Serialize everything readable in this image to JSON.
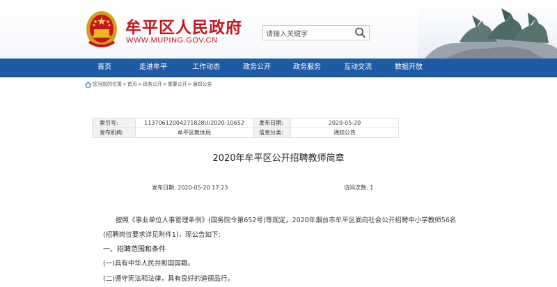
{
  "header": {
    "site_name": "牟平区人民政府",
    "site_url": "WWW.MUPING.GOV.CN",
    "search_placeholder": "请输入关键字"
  },
  "nav": {
    "items": [
      "首页",
      "走进牟平",
      "工作动态",
      "政务公开",
      "政务服务",
      "互动交流",
      "数据开放"
    ]
  },
  "breadcrumb": {
    "items": [
      "您当前的位置",
      "首页",
      "政务公开",
      "重要公开",
      "通知公告"
    ],
    "separator": ">"
  },
  "meta": {
    "index_label": "索引号:",
    "index_value": "11370612004271828U/2020-10652",
    "date_label": "发布日期:",
    "date_value": "2020-05-20",
    "org_label": "发布机构:",
    "org_value": "牟平区教体局",
    "category_label": "信息分类:",
    "category_value": "通知公告"
  },
  "article": {
    "title": "2020年牟平区公开招聘教师简章",
    "publish_time": "发布日期: 2020-05-20 17:23",
    "visits": "访问次数: 1",
    "paragraph1": "按照《事业单位人事管理条例》(国务院令第652号)等规定，2020年烟台市牟平区面向社会公开招聘中小学教师56名(招聘岗位要求详见附件1)，现公告如下:",
    "section1": "一、招聘范围和条件",
    "item1": "(一)具有中华人民共和国国籍。",
    "item2": "(二)遵守宪法和法律，具有良好的道德品行。"
  },
  "colors": {
    "brand_red": "#c5161d",
    "nav_blue": "#1f5aa5"
  },
  "icons": {
    "emblem": "national-emblem-icon",
    "search": "search-icon",
    "home": "home-icon",
    "sculpture": "horse-sculpture-image"
  }
}
